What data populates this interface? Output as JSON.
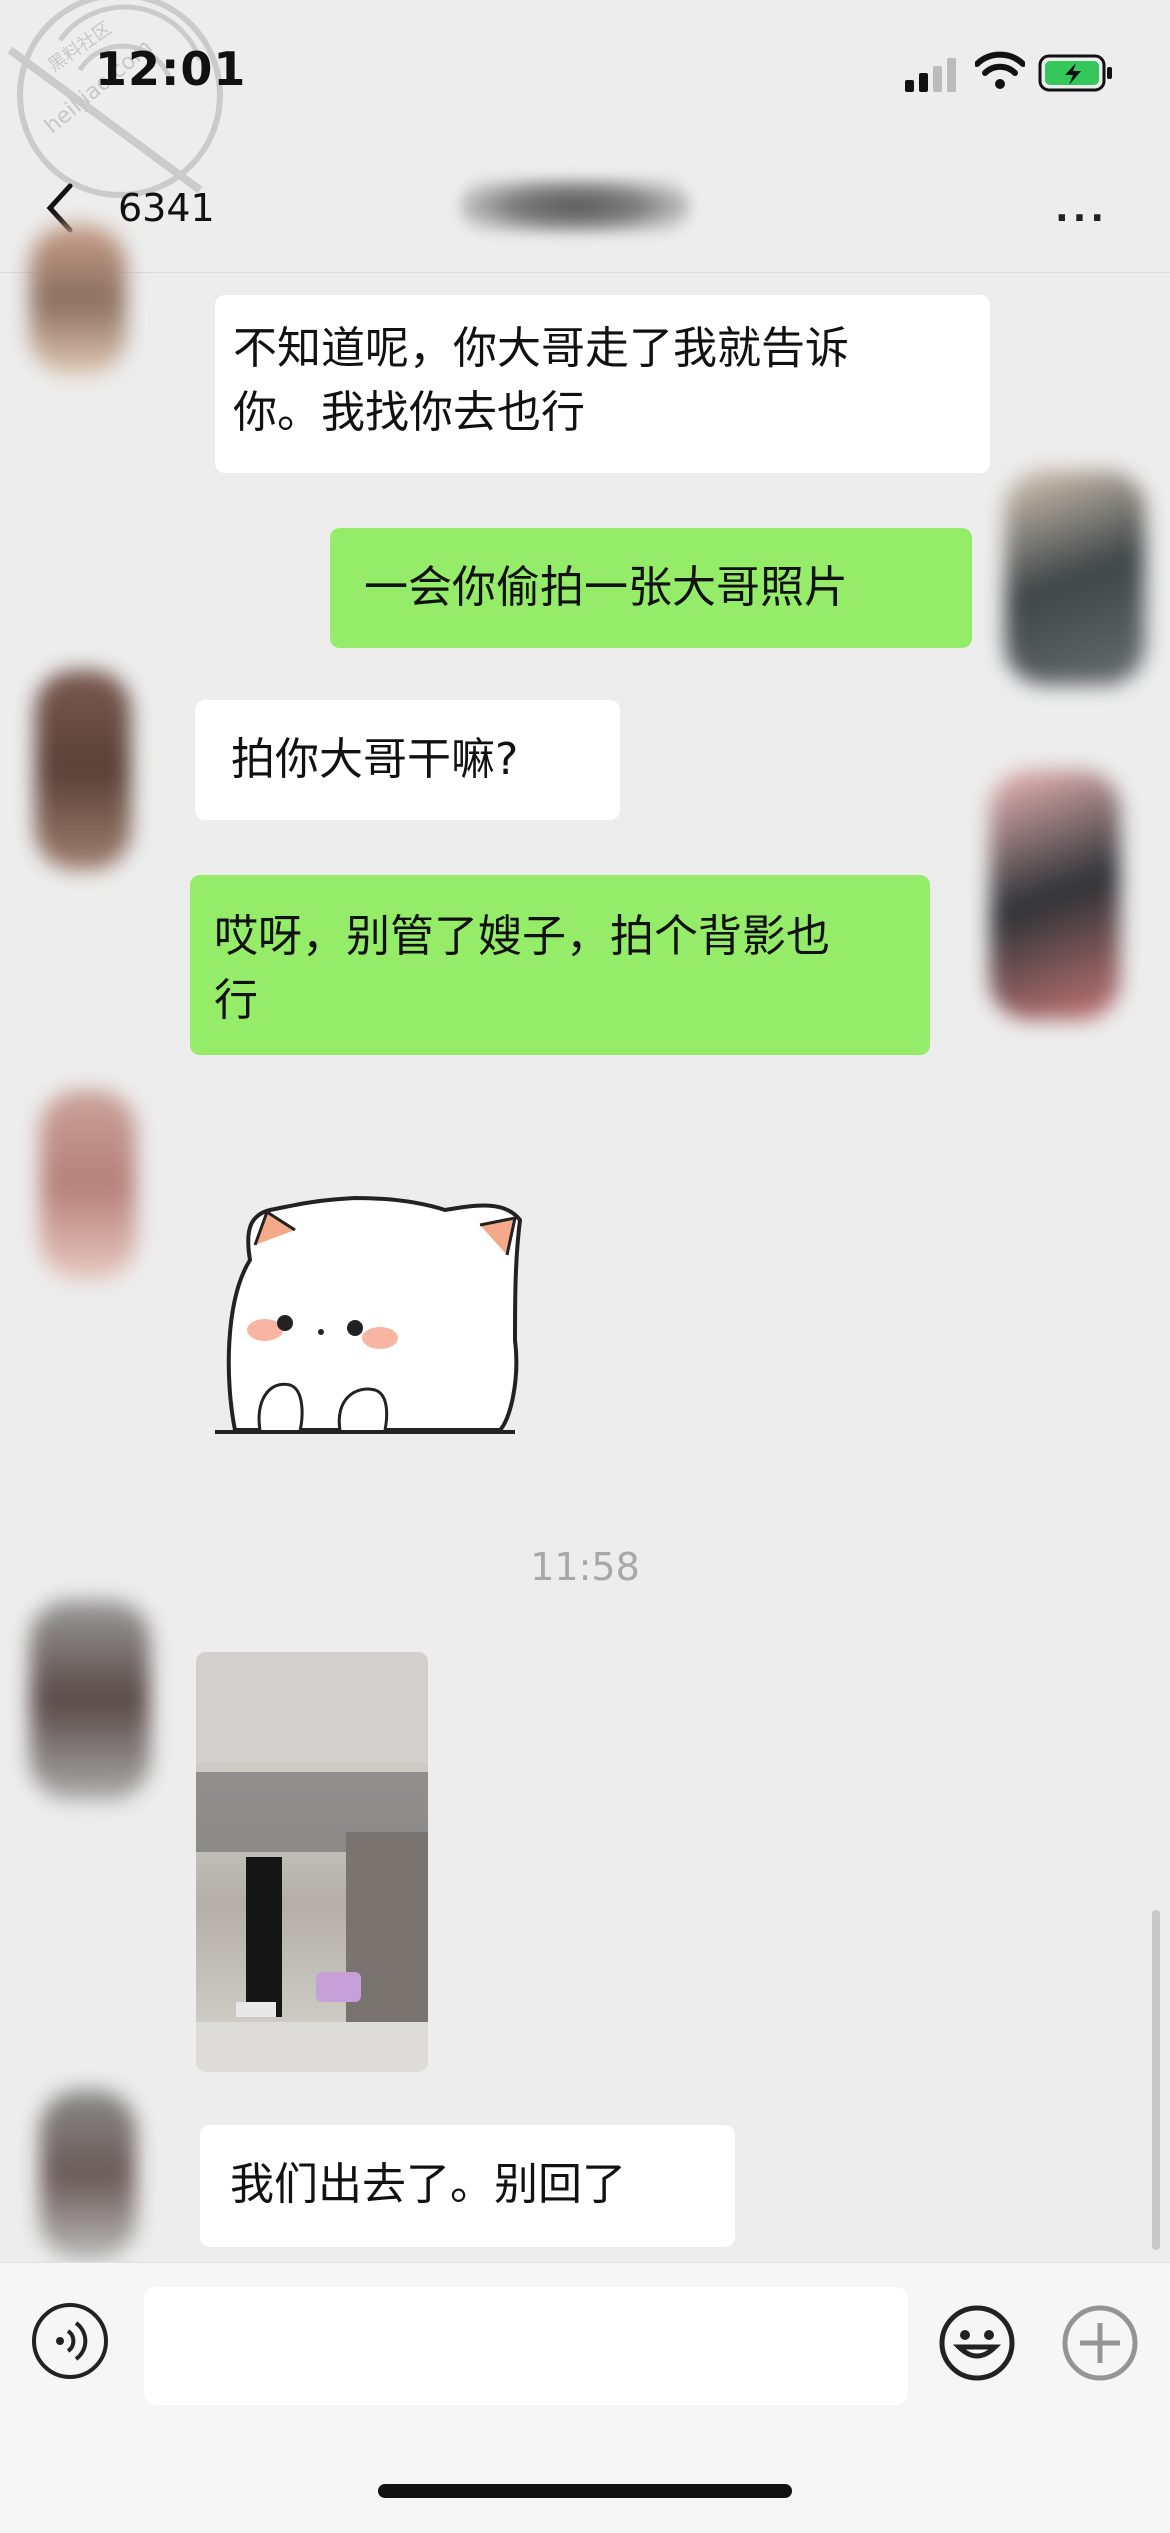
{
  "status_bar": {
    "time": "12:01"
  },
  "watermark": {
    "line1": "黑料社区",
    "line2": "heiljiao.com"
  },
  "nav": {
    "title": "6341",
    "more": "···"
  },
  "messages": [
    {
      "side": "in",
      "text_line1": "不知道呢，你大哥走了我就告诉",
      "text_line2": "你。我找你去也行"
    },
    {
      "side": "out",
      "text": "一会你偷拍一张大哥照片"
    },
    {
      "side": "in",
      "text": "拍你大哥干嘛?"
    },
    {
      "side": "out",
      "text_line1": "哎呀，别管了嫂子，拍个背影也",
      "text_line2": "行"
    },
    {
      "side": "in",
      "type": "sticker",
      "sticker": "white-cat-sticker"
    },
    {
      "side": "in",
      "type": "photo"
    },
    {
      "side": "in",
      "text": "我们出去了。别回了"
    }
  ],
  "timestamp": "11:58",
  "input_bar": {
    "placeholder": ""
  },
  "colors": {
    "background": "#ededed",
    "incoming": "#ffffff",
    "outgoing": "#95ec69"
  }
}
